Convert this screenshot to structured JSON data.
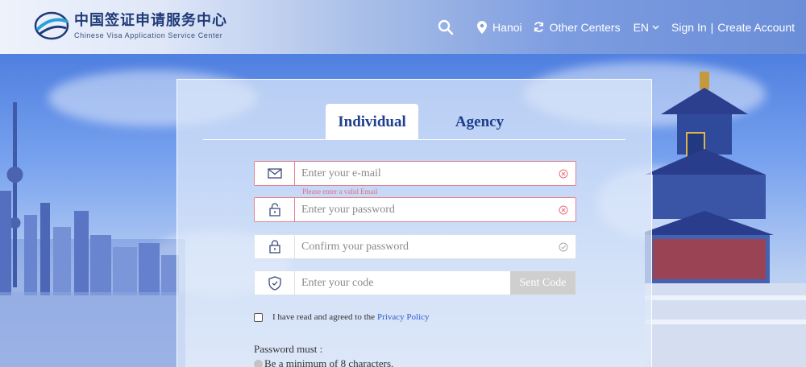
{
  "header": {
    "logo_cn": "中国签证申请服务中心",
    "logo_en": "Chinese Visa Application Service Center",
    "location": "Hanoi",
    "other_centers": "Other Centers",
    "language": "EN",
    "sign_in": "Sign In",
    "separator": "|",
    "create_account": "Create Account"
  },
  "tabs": [
    {
      "label": "Individual",
      "active": true
    },
    {
      "label": "Agency",
      "active": false
    }
  ],
  "form": {
    "email_placeholder": "Enter your e-mail",
    "email_error": "Please enter a valid Email",
    "password_placeholder": "Enter your password",
    "confirm_placeholder": "Confirm your password",
    "code_placeholder": "Enter your code",
    "send_code": "Sent Code",
    "agree_text": "I have read and agreed to the",
    "privacy_link": "Privacy Policy",
    "password_must": "Password must :",
    "rule_1": "Be a minimum of 8 characters."
  },
  "colors": {
    "primary": "#1d3f8c",
    "error": "#e3828e",
    "link": "#2f5bd0"
  }
}
